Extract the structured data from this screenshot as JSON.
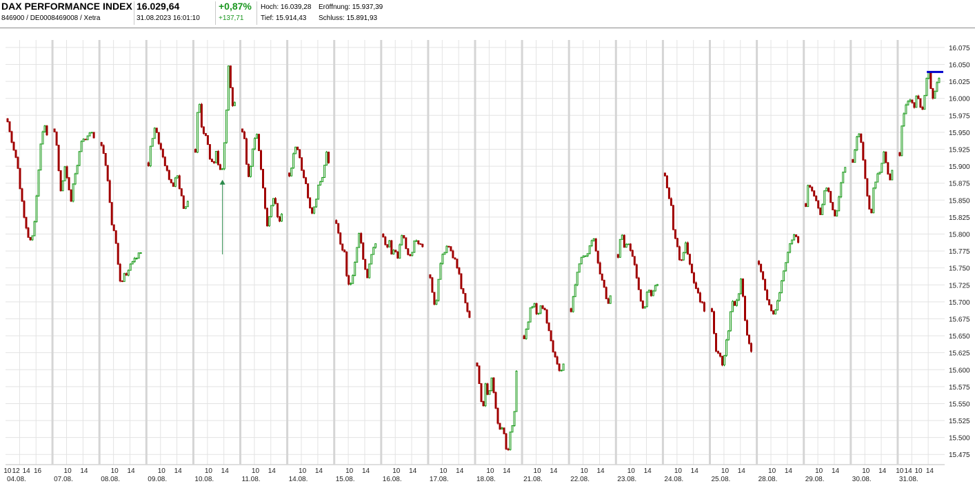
{
  "header": {
    "name": "DAX PERFORMANCE INDEX",
    "ids": "846900 / DE0008469008 / Xetra",
    "last": "16.029,64",
    "datetime": "31.08.2023 16:01:10",
    "change_pct": "+0,87%",
    "change_abs": "+137,71",
    "high_label": "Hoch:",
    "high": "16.039,28",
    "open_label": "Eröffnung:",
    "open": "15.937,39",
    "low_label": "Tief:",
    "low": "15.914,43",
    "close_label": "Schluss:",
    "close": "15.891,93"
  },
  "colors": {
    "up": "#1a9a1a",
    "down": "#a00000",
    "grid": "#e3e3e3",
    "day_separator": "#d5d5d5",
    "marker_line": "#0000cc",
    "arrow": "#2a8a4a",
    "change_positive": "#19961e"
  },
  "chart_data": {
    "type": "candlestick",
    "ylim": [
      15460,
      16080
    ],
    "y_ticks": [
      "16.075",
      "16.050",
      "16.025",
      "16.000",
      "15.975",
      "15.950",
      "15.925",
      "15.900",
      "15.875",
      "15.850",
      "15.825",
      "15.800",
      "15.775",
      "15.750",
      "15.725",
      "15.700",
      "15.675",
      "15.650",
      "15.625",
      "15.600",
      "15.575",
      "15.550",
      "15.525",
      "15.500",
      "15.475"
    ],
    "hour_ticks": [
      "10",
      "12",
      "14",
      "16",
      "10",
      "14",
      "10",
      "14",
      "10",
      "14",
      "10",
      "14",
      "10",
      "14",
      "10",
      "14",
      "10",
      "14",
      "10",
      "14",
      "10",
      "14",
      "10",
      "14",
      "10",
      "14",
      "10",
      "14",
      "10",
      "14",
      "10",
      "14",
      "10",
      "14",
      "10",
      "14",
      "10",
      "14",
      "10",
      "14",
      "10",
      "14",
      "10",
      "14",
      "10",
      "12",
      "14",
      "16"
    ],
    "days": [
      {
        "date": "04.08.",
        "path": [
          15970,
          15940,
          15920,
          15905,
          15860,
          15830,
          15800,
          15790,
          15805,
          15870,
          15930,
          15960,
          15950
        ]
      },
      {
        "date": "07.08.",
        "path": [
          15955,
          15910,
          15860,
          15900,
          15880,
          15850,
          15880,
          15905,
          15930,
          15945,
          15940,
          15950,
          15945
        ]
      },
      {
        "date": "08.08.",
        "path": [
          15935,
          15910,
          15870,
          15820,
          15800,
          15760,
          15720,
          15740,
          15745,
          15760,
          15765,
          15770,
          15775
        ]
      },
      {
        "date": "09.08.",
        "path": [
          15905,
          15940,
          15960,
          15930,
          15915,
          15895,
          15880,
          15870,
          15890,
          15860,
          15835,
          15850
        ]
      },
      {
        "date": "10.08.",
        "path": [
          15925,
          16005,
          15960,
          15950,
          15930,
          15910,
          15905,
          15925,
          15890,
          15900,
          15960,
          16055,
          15990,
          15995
        ]
      },
      {
        "date": "11.08.",
        "path": [
          15955,
          15930,
          15875,
          15900,
          15940,
          15950,
          15920,
          15880,
          15840,
          15810,
          15835,
          15855,
          15840,
          15820,
          15830
        ]
      },
      {
        "date": "14.08.",
        "path": [
          15890,
          15900,
          15925,
          15930,
          15910,
          15890,
          15880,
          15860,
          15840,
          15830,
          15850,
          15870,
          15880,
          15890,
          15920,
          15905
        ]
      },
      {
        "date": "15.08.",
        "path": [
          15820,
          15790,
          15780,
          15770,
          15730,
          15720,
          15740,
          15770,
          15800,
          15780,
          15750,
          15735,
          15760,
          15775,
          15785
        ]
      },
      {
        "date": "16.08.",
        "path": [
          15800,
          15780,
          15790,
          15770,
          15780,
          15760,
          15785,
          15800,
          15780,
          15770,
          15760,
          15790,
          15795,
          15785,
          15780
        ]
      },
      {
        "date": "17.08.",
        "path": [
          15740,
          15700,
          15690,
          15740,
          15760,
          15775,
          15780,
          15785,
          15770,
          15760,
          15745,
          15720,
          15710,
          15690,
          15675
        ]
      },
      {
        "date": "18.08.",
        "path": [
          15610,
          15570,
          15540,
          15580,
          15560,
          15590,
          15560,
          15530,
          15510,
          15520,
          15490,
          15480,
          15510,
          15520,
          15595
        ]
      },
      {
        "date": "21.08.",
        "path": [
          15650,
          15660,
          15690,
          15700,
          15680,
          15690,
          15695,
          15670,
          15650,
          15625,
          15610,
          15600,
          15605
        ]
      },
      {
        "date": "22.08.",
        "path": [
          15690,
          15720,
          15745,
          15760,
          15770,
          15775,
          15785,
          15790,
          15760,
          15740,
          15720,
          15700,
          15705
        ]
      },
      {
        "date": "23.08.",
        "path": [
          15770,
          15800,
          15780,
          15790,
          15770,
          15760,
          15730,
          15700,
          15690,
          15720,
          15710,
          15715,
          15730
        ]
      },
      {
        "date": "24.08.",
        "path": [
          15890,
          15860,
          15840,
          15800,
          15780,
          15760,
          15770,
          15790,
          15760,
          15740,
          15720,
          15710,
          15700,
          15690
        ]
      },
      {
        "date": "25.08.",
        "path": [
          15690,
          15640,
          15625,
          15620,
          15610,
          15630,
          15650,
          15680,
          15700,
          15690,
          15710,
          15735,
          15700,
          15660,
          15640,
          15630
        ]
      },
      {
        "date": "28.08.",
        "path": [
          15760,
          15740,
          15720,
          15700,
          15690,
          15680,
          15700,
          15720,
          15745,
          15760,
          15780,
          15790,
          15800,
          15790
        ]
      },
      {
        "date": "29.08.",
        "path": [
          15845,
          15880,
          15860,
          15850,
          15840,
          15830,
          15860,
          15870,
          15850,
          15830,
          15820,
          15860,
          15890,
          15900
        ]
      },
      {
        "date": "30.08.",
        "path": [
          15910,
          15930,
          15950,
          15940,
          15910,
          15870,
          15840,
          15830,
          15870,
          15880,
          15890,
          15900,
          15920,
          15895,
          15880,
          15895
        ]
      },
      {
        "date": "31.08.",
        "path": [
          15920,
          15970,
          15990,
          16000,
          15995,
          15985,
          16005,
          15995,
          15985,
          16010,
          16040,
          16020,
          16000,
          16015,
          16030
        ]
      }
    ],
    "marker_level": 16039,
    "arrow_index": 69
  }
}
